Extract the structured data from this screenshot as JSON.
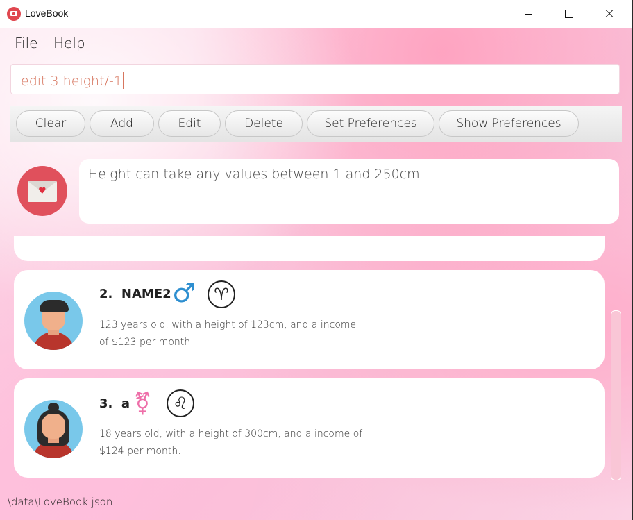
{
  "window": {
    "title": "LoveBook"
  },
  "menu": {
    "file": "File",
    "help": "Help"
  },
  "command": {
    "value": "edit 3 height/-1"
  },
  "toolbar": {
    "buttons": [
      "Clear",
      "Add",
      "Edit",
      "Delete",
      "Set Preferences",
      "Show Preferences"
    ]
  },
  "result": {
    "message": "Height can take any values between 1 and 250cm",
    "icon": "envelope-heart-icon"
  },
  "people": [
    {
      "index": "2.",
      "name": "NAME2",
      "gender": "male",
      "gender_symbol": "♂",
      "gender_color": "#2e8fd0",
      "zodiac": "aries",
      "zodiac_symbol": "♈",
      "description": "123 years old, with a height of 123cm, and a income of $123 per month."
    },
    {
      "index": "3.",
      "name": "a",
      "gender": "female",
      "gender_symbol": "⚧",
      "gender_color": "#ee6fa9",
      "zodiac": "leo",
      "zodiac_symbol": "♌",
      "description": "18 years old, with a height of 300cm, and a income of $124 per month."
    }
  ],
  "status": {
    "path": ".\\data\\LoveBook.json"
  },
  "colors": {
    "accent_pink": "#f9c0d8",
    "command_text": "#d7765f",
    "envelope_circle": "#e0505c"
  }
}
